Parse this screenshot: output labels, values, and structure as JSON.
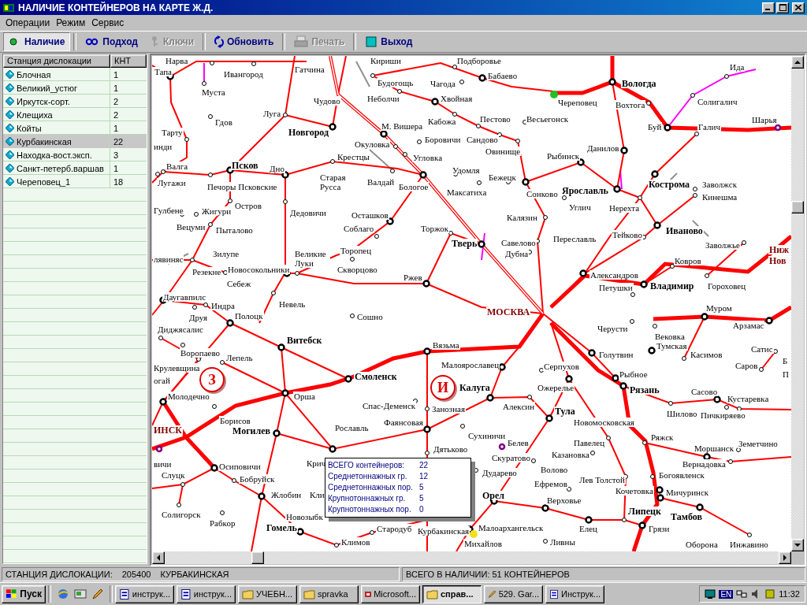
{
  "window": {
    "title": "НАЛИЧИЕ КОНТЕЙНЕРОВ НА КАРТЕ Ж.Д."
  },
  "menu": [
    "Операции",
    "Режим",
    "Сервис"
  ],
  "toolbar": [
    {
      "label": "Наличие",
      "selected": true,
      "disabled": false
    },
    {
      "label": "Подход",
      "selected": false,
      "disabled": false
    },
    {
      "label": "Ключи",
      "selected": false,
      "disabled": true
    },
    {
      "label": "Обновить",
      "selected": false,
      "disabled": false
    },
    {
      "label": "Печать",
      "selected": false,
      "disabled": true
    },
    {
      "label": "Выход",
      "selected": false,
      "disabled": false
    }
  ],
  "table": {
    "columns": [
      "Станция дислокации",
      "КНТ"
    ],
    "rows": [
      {
        "station": "Блочная",
        "count": "1",
        "selected": false
      },
      {
        "station": "Великий_устюг",
        "count": "1",
        "selected": false
      },
      {
        "station": "Иркутск-сорт.",
        "count": "2",
        "selected": false
      },
      {
        "station": "Клещиха",
        "count": "2",
        "selected": false
      },
      {
        "station": "Койты",
        "count": "1",
        "selected": false
      },
      {
        "station": "Курбакинская",
        "count": "22",
        "selected": true
      },
      {
        "station": "Находка-вост.эксп.",
        "count": "3",
        "selected": false
      },
      {
        "station": "Санкт-петерб.варшав",
        "count": "1",
        "selected": false
      },
      {
        "station": "Череповец_1",
        "count": "18",
        "selected": false
      }
    ]
  },
  "map": {
    "stations": [
      {
        "name": "Нарва",
        "kind": "minor"
      },
      {
        "name": "Тапа",
        "kind": "minor"
      },
      {
        "name": "Ивангород",
        "kind": "minor"
      },
      {
        "name": "Муста",
        "kind": "minor"
      },
      {
        "name": "Гатчина",
        "kind": "minor"
      },
      {
        "name": "Кириши",
        "kind": "minor"
      },
      {
        "name": "Подборовье",
        "kind": "minor"
      },
      {
        "name": "Чудово",
        "kind": "minor"
      },
      {
        "name": "Гдов",
        "kind": "minor"
      },
      {
        "name": "Луга",
        "kind": "minor"
      },
      {
        "name": "Тарту",
        "kind": "minor"
      },
      {
        "name": "Новгород",
        "kind": "major"
      },
      {
        "name": "инди",
        "kind": "minor"
      },
      {
        "name": "Окуловка",
        "kind": "minor"
      },
      {
        "name": "Крестцы",
        "kind": "minor"
      },
      {
        "name": "Валга",
        "kind": "minor"
      },
      {
        "name": "Псков",
        "kind": "major"
      },
      {
        "name": "Дно",
        "kind": "minor"
      },
      {
        "name": "Лугажи",
        "kind": "minor"
      },
      {
        "name": "Печоры Псковские",
        "kind": "minor"
      },
      {
        "name": "Старая Русса",
        "kind": "minor"
      },
      {
        "name": "Гулбене",
        "kind": "minor"
      },
      {
        "name": "Жигури",
        "kind": "minor"
      },
      {
        "name": "Остров",
        "kind": "minor"
      },
      {
        "name": "Вецуми",
        "kind": "minor"
      },
      {
        "name": "Пыталово",
        "kind": "minor"
      },
      {
        "name": "Дедовичи",
        "kind": "minor"
      },
      {
        "name": "лявиняс",
        "kind": "minor"
      },
      {
        "name": "Зилупе",
        "kind": "minor"
      },
      {
        "name": "Великие Луки",
        "kind": "minor"
      },
      {
        "name": "Резекне",
        "kind": "minor"
      },
      {
        "name": "Новосокольники",
        "kind": "minor"
      },
      {
        "name": "Себеж",
        "kind": "minor"
      },
      {
        "name": "Даугавпилс",
        "kind": "minor"
      },
      {
        "name": "Индра",
        "kind": "minor"
      },
      {
        "name": "Невель",
        "kind": "minor"
      },
      {
        "name": "Будогощь",
        "kind": "minor"
      },
      {
        "name": "Чагода",
        "kind": "minor"
      },
      {
        "name": "Бабаево",
        "kind": "minor"
      },
      {
        "name": "Неболчи",
        "kind": "minor"
      },
      {
        "name": "Хвойная",
        "kind": "minor"
      },
      {
        "name": "М. Вишера",
        "kind": "minor"
      },
      {
        "name": "Кабожа",
        "kind": "minor"
      },
      {
        "name": "Пестово",
        "kind": "minor"
      },
      {
        "name": "Весьегонск",
        "kind": "minor"
      },
      {
        "name": "Боровичи",
        "kind": "minor"
      },
      {
        "name": "Сандово",
        "kind": "minor"
      },
      {
        "name": "Угловка",
        "kind": "minor"
      },
      {
        "name": "Овинище",
        "kind": "minor"
      },
      {
        "name": "Рыбинск",
        "kind": "minor"
      },
      {
        "name": "Удомля",
        "kind": "minor"
      },
      {
        "name": "Валдай",
        "kind": "minor"
      },
      {
        "name": "Бологое",
        "kind": "minor"
      },
      {
        "name": "Бежецк",
        "kind": "minor"
      },
      {
        "name": "Максатиха",
        "kind": "minor"
      },
      {
        "name": "Сонково",
        "kind": "minor"
      },
      {
        "name": "Ярославль",
        "kind": "major"
      },
      {
        "name": "Осташков",
        "kind": "minor"
      },
      {
        "name": "Углич",
        "kind": "minor"
      },
      {
        "name": "Калязин",
        "kind": "minor"
      },
      {
        "name": "Соблаго",
        "kind": "minor"
      },
      {
        "name": "Торжок",
        "kind": "minor"
      },
      {
        "name": "Торопец",
        "kind": "minor"
      },
      {
        "name": "Тверь",
        "kind": "major"
      },
      {
        "name": "Савелово",
        "kind": "minor"
      },
      {
        "name": "Переславль",
        "kind": "minor"
      },
      {
        "name": "Дубна",
        "kind": "minor"
      },
      {
        "name": "Скворцово",
        "kind": "minor"
      },
      {
        "name": "Ржев",
        "kind": "minor"
      },
      {
        "name": "Вологда",
        "kind": "major"
      },
      {
        "name": "Череповец",
        "kind": "minor"
      },
      {
        "name": "Вохтога",
        "kind": "minor"
      },
      {
        "name": "Ида",
        "kind": "minor"
      },
      {
        "name": "Солигалич",
        "kind": "minor"
      },
      {
        "name": "Шарья",
        "kind": "minor"
      },
      {
        "name": "Буй",
        "kind": "minor"
      },
      {
        "name": "Галич",
        "kind": "minor"
      },
      {
        "name": "Данилов",
        "kind": "minor"
      },
      {
        "name": "Кострома",
        "kind": "major"
      },
      {
        "name": "Заволжск",
        "kind": "minor"
      },
      {
        "name": "Кинешма",
        "kind": "minor"
      },
      {
        "name": "Нерехта",
        "kind": "minor"
      },
      {
        "name": "Тейково",
        "kind": "minor"
      },
      {
        "name": "Иваново",
        "kind": "major"
      },
      {
        "name": "Заволжье",
        "kind": "minor"
      },
      {
        "name": "Ниж",
        "kind": "capital"
      },
      {
        "name": "Нов",
        "kind": "capital"
      },
      {
        "name": "Александров",
        "kind": "minor"
      },
      {
        "name": "Ковров",
        "kind": "minor"
      },
      {
        "name": "Петушки",
        "kind": "minor"
      },
      {
        "name": "Владимир",
        "kind": "major"
      },
      {
        "name": "Гороховец",
        "kind": "minor"
      },
      {
        "name": "Муром",
        "kind": "minor"
      },
      {
        "name": "Черусти",
        "kind": "minor"
      },
      {
        "name": "Арзамас",
        "kind": "minor"
      },
      {
        "name": "Вековка",
        "kind": "minor"
      },
      {
        "name": "Голутвин",
        "kind": "minor"
      },
      {
        "name": "Тумская",
        "kind": "minor"
      },
      {
        "name": "Касимов",
        "kind": "minor"
      },
      {
        "name": "Сатис",
        "kind": "minor"
      },
      {
        "name": "Рыбное",
        "kind": "minor"
      },
      {
        "name": "Саров",
        "kind": "minor"
      },
      {
        "name": "Б",
        "kind": "minor"
      },
      {
        "name": "П",
        "kind": "minor"
      },
      {
        "name": "Рязань",
        "kind": "major"
      },
      {
        "name": "Сасово",
        "kind": "minor"
      },
      {
        "name": "Кустаревка",
        "kind": "minor"
      },
      {
        "name": "Новомосковская",
        "kind": "minor"
      },
      {
        "name": "Шилово",
        "kind": "minor"
      },
      {
        "name": "Пичкиряево",
        "kind": "minor"
      },
      {
        "name": "Павелец",
        "kind": "minor"
      },
      {
        "name": "Ряжск",
        "kind": "minor"
      },
      {
        "name": "Казановка",
        "kind": "minor"
      },
      {
        "name": "Моршанск",
        "kind": "minor"
      },
      {
        "name": "Земетчино",
        "kind": "minor"
      },
      {
        "name": "Вернадовка",
        "kind": "minor"
      },
      {
        "name": "Лев Толстой",
        "kind": "minor"
      },
      {
        "name": "Богоявленск",
        "kind": "minor"
      },
      {
        "name": "Кочетовка",
        "kind": "minor"
      },
      {
        "name": "Мичуринск",
        "kind": "minor"
      },
      {
        "name": "Липецк",
        "kind": "major"
      },
      {
        "name": "Тамбов",
        "kind": "major"
      },
      {
        "name": "Елец",
        "kind": "minor"
      },
      {
        "name": "Грязи",
        "kind": "minor"
      },
      {
        "name": "Оборона",
        "kind": "minor"
      },
      {
        "name": "Инжавино",
        "kind": "minor"
      },
      {
        "name": "Друя",
        "kind": "minor"
      },
      {
        "name": "Полоцк",
        "kind": "minor"
      },
      {
        "name": "Диджясалис",
        "kind": "minor"
      },
      {
        "name": "Витебск",
        "kind": "major"
      },
      {
        "name": "Воропаево",
        "kind": "minor"
      },
      {
        "name": "Лепель",
        "kind": "minor"
      },
      {
        "name": "Крулевщина",
        "kind": "minor"
      },
      {
        "name": "огай",
        "kind": "minor"
      },
      {
        "name": "Молодечно",
        "kind": "minor"
      },
      {
        "name": "Орша",
        "kind": "minor"
      },
      {
        "name": "ИНСК",
        "kind": "capital"
      },
      {
        "name": "Борисов",
        "kind": "minor"
      },
      {
        "name": "Могилев",
        "kind": "major"
      },
      {
        "name": "Рославль",
        "kind": "minor"
      },
      {
        "name": "вичи",
        "kind": "minor"
      },
      {
        "name": "Слуцк",
        "kind": "minor"
      },
      {
        "name": "Осиповичи",
        "kind": "minor"
      },
      {
        "name": "Крич",
        "kind": "minor"
      },
      {
        "name": "Бобруйск",
        "kind": "minor"
      },
      {
        "name": "Жлобин",
        "kind": "minor"
      },
      {
        "name": "Солигорск",
        "kind": "minor"
      },
      {
        "name": "Рабкор",
        "kind": "minor"
      },
      {
        "name": "Кли",
        "kind": "minor"
      },
      {
        "name": "Новозыбк",
        "kind": "minor"
      },
      {
        "name": "Гомель",
        "kind": "major"
      },
      {
        "name": "Климов",
        "kind": "minor"
      },
      {
        "name": "Стародуб",
        "kind": "minor"
      },
      {
        "name": "Курбакинская",
        "kind": "minor"
      },
      {
        "name": "Сошно",
        "kind": "minor"
      },
      {
        "name": "МОСКВА",
        "kind": "capital"
      },
      {
        "name": "Вязьма",
        "kind": "minor"
      },
      {
        "name": "Малоярославец",
        "kind": "minor"
      },
      {
        "name": "Серпухов",
        "kind": "minor"
      },
      {
        "name": "Смоленск",
        "kind": "major"
      },
      {
        "name": "Калуга",
        "kind": "major"
      },
      {
        "name": "Ожерелье",
        "kind": "minor"
      },
      {
        "name": "Спас-Деменск",
        "kind": "minor"
      },
      {
        "name": "Занозная",
        "kind": "minor"
      },
      {
        "name": "Алексин",
        "kind": "minor"
      },
      {
        "name": "Тула",
        "kind": "major"
      },
      {
        "name": "Фаянсовая",
        "kind": "minor"
      },
      {
        "name": "Сухиничи",
        "kind": "minor"
      },
      {
        "name": "Дятьково",
        "kind": "minor"
      },
      {
        "name": "Белев",
        "kind": "minor"
      },
      {
        "name": "Скуратово",
        "kind": "minor"
      },
      {
        "name": "Дударево",
        "kind": "minor"
      },
      {
        "name": "Волово",
        "kind": "minor"
      },
      {
        "name": "Ефремов",
        "kind": "minor"
      },
      {
        "name": "Орел",
        "kind": "major"
      },
      {
        "name": "Верховье",
        "kind": "minor"
      },
      {
        "name": "Малоархангельск",
        "kind": "minor"
      },
      {
        "name": "Михайлов",
        "kind": "minor"
      },
      {
        "name": "Ливны",
        "kind": "minor"
      }
    ],
    "regions": [
      {
        "letter": "З"
      },
      {
        "letter": "И"
      }
    ],
    "markers": [
      {
        "color": "#22c022"
      },
      {
        "color": "#f0e020"
      }
    ],
    "tooltip": {
      "rows": [
        {
          "label": "ВСЕГО контейнеров:",
          "value": "22"
        },
        {
          "label": "Среднетоннажных гр.",
          "value": "12"
        },
        {
          "label": "Среднетоннажных пор.",
          "value": "5"
        },
        {
          "label": "Крупнотоннажных гр.",
          "value": "5"
        },
        {
          "label": "Крупнотоннажных пор.",
          "value": "0"
        }
      ]
    }
  },
  "status_bar": {
    "label": "СТАНЦИЯ ДИСЛОКАЦИИ:",
    "code": "205400",
    "station": "КУРБАКИНСКАЯ",
    "total": "ВСЕГО В НАЛИЧИИ: 51 КОНТЕЙНЕРОВ"
  },
  "taskbar": {
    "start": "Пуск",
    "tasks": [
      {
        "label": "инструк...",
        "selected": false
      },
      {
        "label": "инструк...",
        "selected": false
      },
      {
        "label": "УЧЕБН...",
        "selected": false
      },
      {
        "label": "spravka",
        "selected": false
      },
      {
        "label": "Microsoft...",
        "selected": false
      },
      {
        "label": "справ...",
        "selected": true
      },
      {
        "label": "529. Gar...",
        "selected": false
      },
      {
        "label": "Инструк...",
        "selected": false
      }
    ],
    "language": "EN",
    "clock": "11:32"
  }
}
